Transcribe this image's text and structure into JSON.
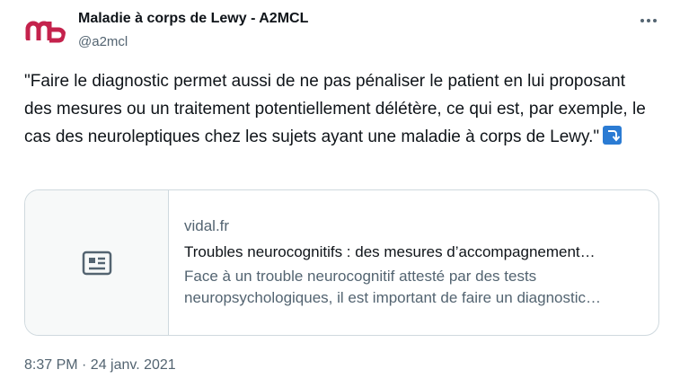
{
  "author": {
    "name": "Maladie à corps de Lewy - A2MCL",
    "handle": "@a2mcl",
    "avatar_color": "#c4224c"
  },
  "tweet": {
    "text": "\"Faire le diagnostic permet aussi de ne pas pénaliser le patient en lui proposant des mesures ou un traitement potentiellement délétère, ce qui est, par exemple, le cas des neuroleptiques chez les sujets ayant une maladie à corps de Lewy.\"",
    "emoji": "right-arrow-curving-down",
    "timestamp": "8:37 PM · 24 janv. 2021"
  },
  "card": {
    "domain": "vidal.fr",
    "title": "Troubles neurocognitifs : des mesures d’accompagnement…",
    "description_line1": "Face à un trouble neurocognitif attesté par des tests",
    "description_line2": "neuropsychologiques, il est important de faire un diagnostic…",
    "thumb_icon": "article-icon"
  },
  "menu": {
    "icon": "more-dots-icon"
  }
}
